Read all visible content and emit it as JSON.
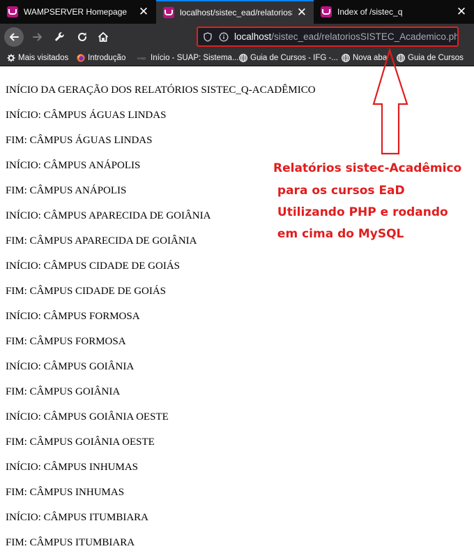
{
  "browser": {
    "tabs": [
      {
        "title": "WAMPSERVER Homepage",
        "active": false
      },
      {
        "title": "localhost/sistec_ead/relatoriosSIS",
        "active": true
      },
      {
        "title": "Index of /sistec_q",
        "active": false
      }
    ],
    "tab_close_glyph": "✕",
    "url": {
      "host": "localhost",
      "path": "/sistec_ead/relatoriosSISTEC_Academico.php"
    },
    "bookmarks": [
      {
        "label": "Mais visitados",
        "icon": "gear-icon"
      },
      {
        "label": "Introdução",
        "icon": "firefox-icon"
      },
      {
        "label": "Início - SUAP: Sistema...",
        "icon": "suap-icon"
      },
      {
        "label": "Guia de Cursos - IFG -...",
        "icon": "globe-icon"
      },
      {
        "label": "Nova aba",
        "icon": "globe-icon"
      },
      {
        "label": "Guia de Cursos",
        "icon": "globe-icon"
      }
    ]
  },
  "page": {
    "lines": [
      "INÍCIO DA GERAÇÃO DOS RELATÓRIOS SISTEC_Q-ACADÊMICO",
      "INÍCIO: CÂMPUS ÁGUAS LINDAS",
      "FIM: CÂMPUS ÁGUAS LINDAS",
      "INÍCIO: CÂMPUS ANÁPOLIS",
      "FIM: CÂMPUS ANÁPOLIS",
      "INÍCIO: CÂMPUS APARECIDA DE GOIÂNIA",
      "FIM: CÂMPUS APARECIDA DE GOIÂNIA",
      "INÍCIO: CÂMPUS CIDADE DE GOIÁS",
      "FIM: CÂMPUS CIDADE DE GOIÁS",
      "INÍCIO: CÂMPUS FORMOSA",
      "FIM: CÂMPUS FORMOSA",
      "INÍCIO: CÂMPUS GOIÂNIA",
      "FIM: CÂMPUS GOIÂNIA",
      "INÍCIO: CÂMPUS GOIÂNIA OESTE",
      "FIM: CÂMPUS GOIÂNIA OESTE",
      "INÍCIO: CÂMPUS INHUMAS",
      "FIM: CÂMPUS INHUMAS",
      "INÍCIO: CÂMPUS ITUMBIARA",
      "FIM: CÂMPUS ITUMBIARA"
    ]
  },
  "annotation": {
    "lines": [
      "Relatórios sistec-Acadêmico",
      " para os cursos EaD",
      " Utilizando PHP e rodando",
      " em cima do MySQL"
    ],
    "color": "#e11d1d"
  }
}
